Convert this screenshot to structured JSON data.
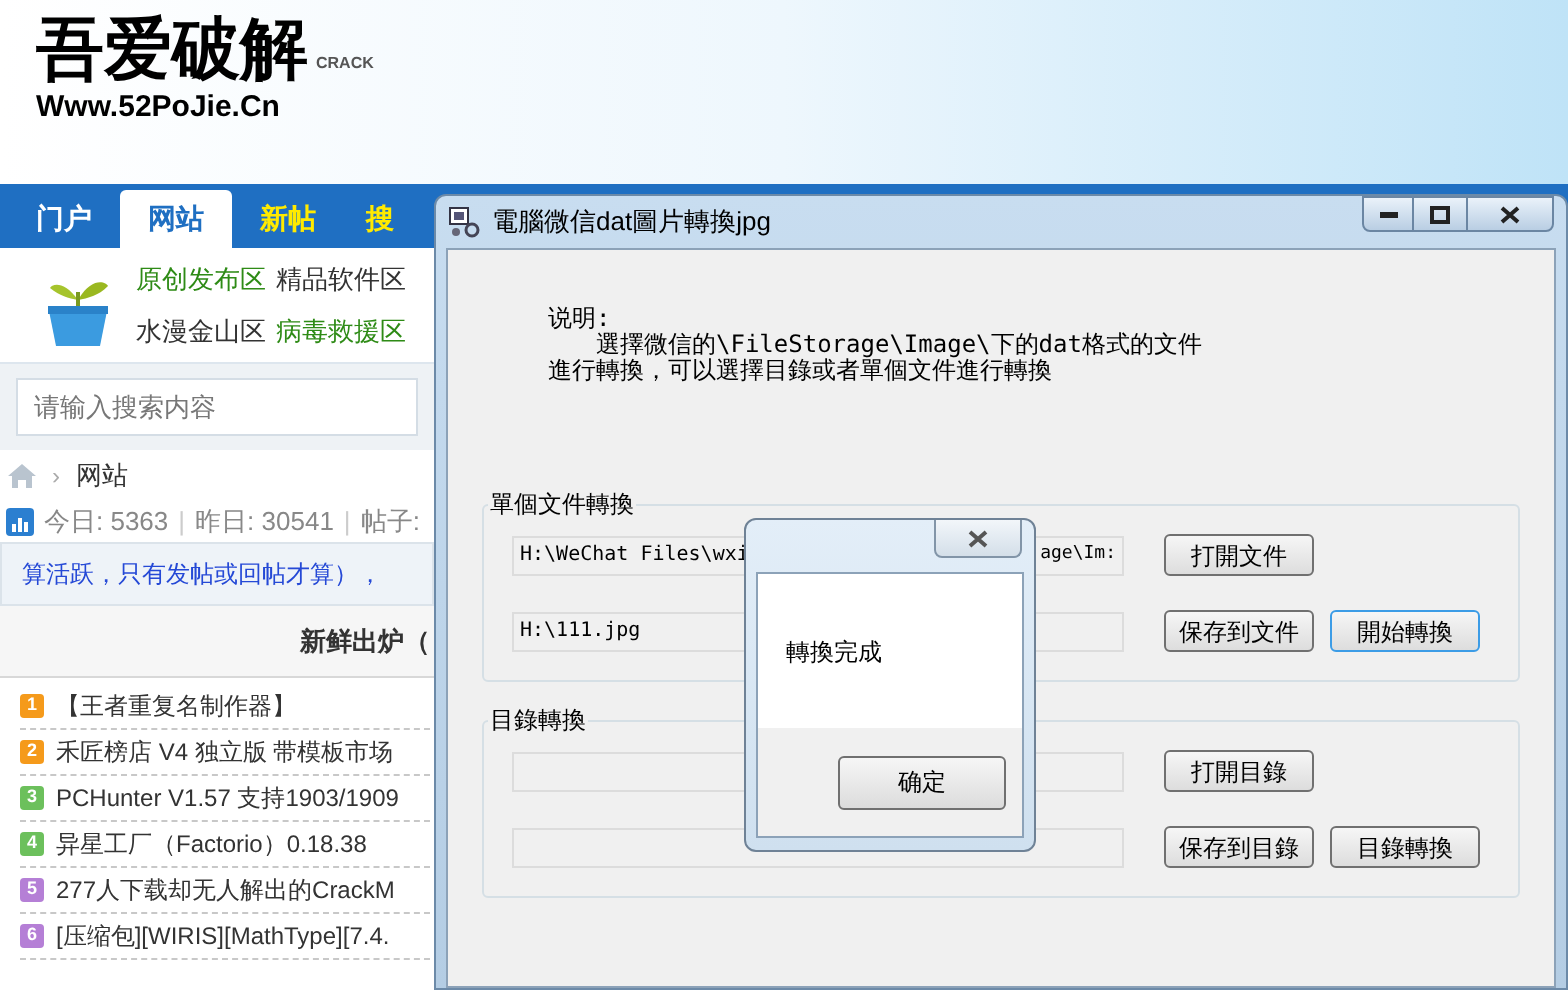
{
  "site": {
    "logo": {
      "name": "吾爱破解",
      "tag": "CRACK",
      "url": "Www.52PoJie.Cn"
    },
    "nav": [
      {
        "label": "门户",
        "selected": false,
        "kind": "plain"
      },
      {
        "label": "网站",
        "selected": true,
        "kind": "plain"
      },
      {
        "label": "新帖",
        "selected": false,
        "kind": "highlight"
      },
      {
        "label": "搜",
        "selected": false,
        "kind": "highlight"
      }
    ],
    "forum_links": [
      [
        {
          "label": "原创发布区",
          "color": "#2e8b16"
        },
        {
          "label": "精品软件区",
          "color": "#333333"
        }
      ],
      [
        {
          "label": "水漫金山区",
          "color": "#333333"
        },
        {
          "label": "病毒救援区",
          "color": "#2e8b16"
        }
      ]
    ],
    "search": {
      "placeholder": "请输入搜索内容"
    },
    "breadcrumb": [
      {
        "kind": "separator",
        "text": "›"
      },
      {
        "kind": "link",
        "text": "网站"
      }
    ],
    "stats": [
      {
        "kind": "stat",
        "text": "今日: 5363"
      },
      {
        "kind": "separator",
        "text": "|"
      },
      {
        "kind": "stat",
        "text": "昨日: 30541"
      },
      {
        "kind": "separator",
        "text": "|"
      },
      {
        "kind": "stat",
        "text": "帖子:"
      }
    ],
    "notice": "算活跃，只有发帖或回帖才算），",
    "list_title": "新鲜出炉（",
    "threads": [
      {
        "rank": "1",
        "title": "【王者重复名制作器】",
        "color": "#f59a1b"
      },
      {
        "rank": "2",
        "title": "禾匠榜店 V4 独立版 带模板市场",
        "color": "#f59a1b"
      },
      {
        "rank": "3",
        "title": "PCHunter V1.57 支持1903/1909",
        "color": "#6cc05c"
      },
      {
        "rank": "4",
        "title": "异星工厂（Factorio）0.18.38",
        "color": "#6cc05c"
      },
      {
        "rank": "5",
        "title": "277人下载却无人解出的CrackM",
        "color": "#b57fd6"
      },
      {
        "rank": "6",
        "title": "[压缩包][WIRIS][MathType][7.4.",
        "color": "#b57fd6"
      }
    ]
  },
  "dialog": {
    "title": "電腦微信dat圖片轉換jpg",
    "description": [
      "说明:",
      "選擇微信的\\FileStorage\\Image\\下的dat格式的文件",
      "進行轉換，可以選擇目錄或者單個文件進行轉換"
    ],
    "groups": [
      {
        "label": "單個文件轉換",
        "rows": [
          {
            "field": {
              "value": "H:\\WeChat Files\\wxi",
              "value_end": "age\\Im:"
            },
            "buttons": [
              {
                "label": "打開文件",
                "focused": false
              }
            ]
          },
          {
            "field": {
              "value": "H:\\111.jpg"
            },
            "buttons": [
              {
                "label": "保存到文件",
                "focused": false
              },
              {
                "label": "開始轉換",
                "focused": true
              }
            ]
          }
        ]
      },
      {
        "label": "目錄轉換",
        "rows": [
          {
            "field": {},
            "buttons": [
              {
                "label": "打開目錄",
                "focused": false
              }
            ]
          },
          {
            "field": {},
            "buttons": [
              {
                "label": "保存到目錄",
                "focused": false
              },
              {
                "label": "目錄轉換",
                "focused": false
              }
            ]
          }
        ]
      }
    ]
  },
  "message_box": {
    "text": "轉換完成",
    "button": "确定"
  }
}
